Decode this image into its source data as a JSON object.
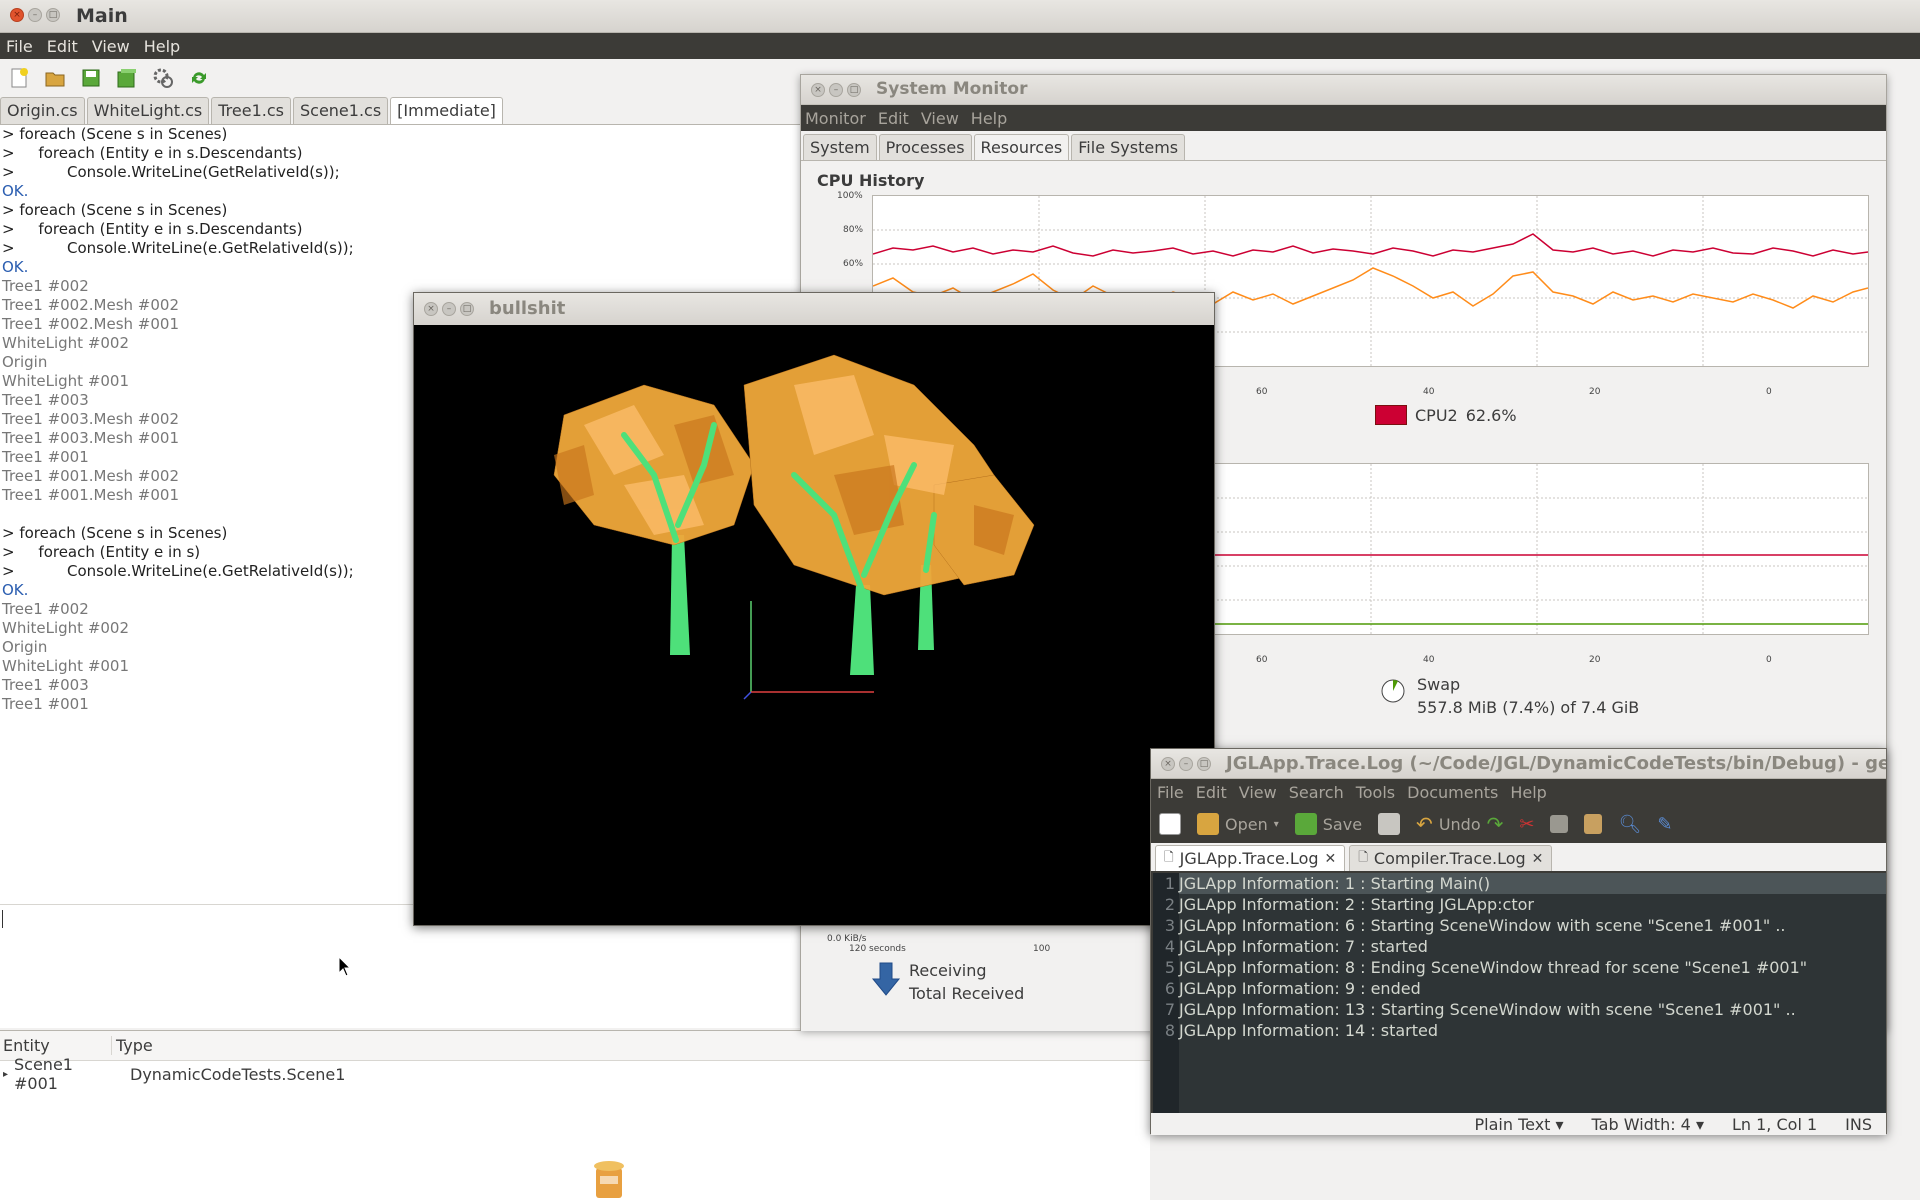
{
  "main": {
    "title": "Main",
    "menu": [
      "File",
      "Edit",
      "View",
      "Help"
    ],
    "tabs": [
      "Origin.cs",
      "WhiteLight.cs",
      "Tree1.cs",
      "Scene1.cs",
      "[Immediate]"
    ],
    "console_lines": [
      {
        "t": "> foreach (Scene s in Scenes)",
        "k": "cmd"
      },
      {
        "t": ">     foreach (Entity e in s.Descendants)",
        "k": "cmd"
      },
      {
        "t": ">           Console.WriteLine(GetRelativeId(s));",
        "k": "cmd"
      },
      {
        "t": "OK.",
        "k": "ok"
      },
      {
        "t": "> foreach (Scene s in Scenes)",
        "k": "cmd"
      },
      {
        "t": ">     foreach (Entity e in s.Descendants)",
        "k": "cmd"
      },
      {
        "t": ">           Console.WriteLine(e.GetRelativeId(s));",
        "k": "cmd"
      },
      {
        "t": "OK.",
        "k": "ok"
      },
      {
        "t": "Tree1 #002",
        "k": "out"
      },
      {
        "t": "Tree1 #002.Mesh #002",
        "k": "out"
      },
      {
        "t": "Tree1 #002.Mesh #001",
        "k": "out"
      },
      {
        "t": "WhiteLight #002",
        "k": "out"
      },
      {
        "t": "Origin",
        "k": "out"
      },
      {
        "t": "WhiteLight #001",
        "k": "out"
      },
      {
        "t": "Tree1 #003",
        "k": "out"
      },
      {
        "t": "Tree1 #003.Mesh #002",
        "k": "out"
      },
      {
        "t": "Tree1 #003.Mesh #001",
        "k": "out"
      },
      {
        "t": "Tree1 #001",
        "k": "out"
      },
      {
        "t": "Tree1 #001.Mesh #002",
        "k": "out"
      },
      {
        "t": "Tree1 #001.Mesh #001",
        "k": "out"
      },
      {
        "t": "",
        "k": "out"
      },
      {
        "t": "> foreach (Scene s in Scenes)",
        "k": "cmd"
      },
      {
        "t": ">     foreach (Entity e in s)",
        "k": "cmd"
      },
      {
        "t": ">           Console.WriteLine(e.GetRelativeId(s));",
        "k": "cmd"
      },
      {
        "t": "OK.",
        "k": "ok"
      },
      {
        "t": "Tree1 #002",
        "k": "out"
      },
      {
        "t": "WhiteLight #002",
        "k": "out"
      },
      {
        "t": "Origin",
        "k": "out"
      },
      {
        "t": "WhiteLight #001",
        "k": "out"
      },
      {
        "t": "Tree1 #003",
        "k": "out"
      },
      {
        "t": "Tree1 #001",
        "k": "out"
      }
    ],
    "entity_table": {
      "headers": [
        "Entity",
        "Type"
      ],
      "row": {
        "entity": "Scene1 #001",
        "type": "DynamicCodeTests.Scene1"
      }
    }
  },
  "sysmon": {
    "title": "System Monitor",
    "menu": [
      "Monitor",
      "Edit",
      "View",
      "Help"
    ],
    "tabs": [
      "System",
      "Processes",
      "Resources",
      "File Systems"
    ],
    "cpu_title": "CPU History",
    "cpu_y_ticks": [
      "100%",
      "80%",
      "60%"
    ],
    "x_ticks": [
      "60",
      "40",
      "20",
      "0"
    ],
    "cpu_legend": {
      "label": "CPU2",
      "value": "62.6%",
      "color": "#cc0033"
    },
    "swap": {
      "label": "Swap",
      "value": "557.8 MiB (7.4%) of 7.4 GiB"
    },
    "net": {
      "y_tick": "0.0 KiB/s",
      "x_start": "120 seconds",
      "x_100": "100",
      "receiving": "Receiving",
      "total_received": "Total Received"
    }
  },
  "bwin": {
    "title": "bullshit"
  },
  "gedit": {
    "title": "JGLApp.Trace.Log (~/Code/JGL/DynamicCodeTests/bin/Debug) - ge",
    "menu": [
      "File",
      "Edit",
      "View",
      "Search",
      "Tools",
      "Documents",
      "Help"
    ],
    "toolbar": {
      "open": "Open",
      "save": "Save",
      "undo": "Undo"
    },
    "tabs": [
      "JGLApp.Trace.Log",
      "Compiler.Trace.Log"
    ],
    "lines": [
      "JGLApp Information: 1 : Starting Main()",
      "JGLApp Information: 2 : Starting JGLApp:ctor",
      "JGLApp Information: 6 : Starting SceneWindow with scene \"Scene1 #001\" ..",
      "JGLApp Information: 7 : started",
      "JGLApp Information: 8 : Ending SceneWindow thread for scene \"Scene1 #001\"",
      "JGLApp Information: 9 : ended",
      "JGLApp Information: 13 : Starting SceneWindow with scene \"Scene1 #001\" ..",
      "JGLApp Information: 14 : started"
    ],
    "status": {
      "syntax": "Plain Text ▾",
      "tab_width": "Tab Width: 4 ▾",
      "position": "Ln 1, Col 1",
      "mode": "INS"
    }
  }
}
